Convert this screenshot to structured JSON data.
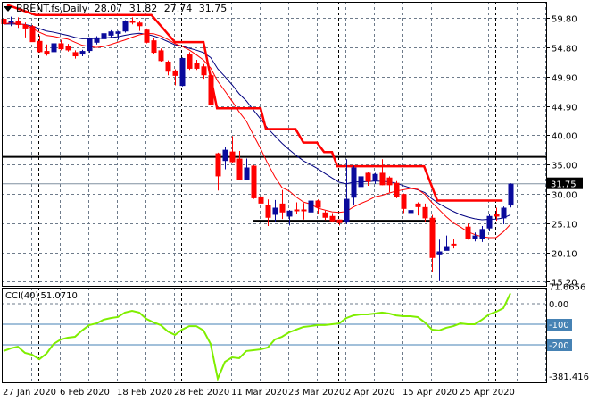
{
  "header": {
    "symbol": "BRENT.fs,Daily",
    "open": "28.07",
    "high": "31.82",
    "low": "27.74",
    "close": "31.75"
  },
  "cci_header": {
    "name": "CCI(40)",
    "value": "51.0710"
  },
  "colors": {
    "bull": "#0a0a9c",
    "bear": "#ff0000",
    "ma_blue": "#000080",
    "ma_red": "#ff0000",
    "step": "#ff0000",
    "cci": "#7fee00",
    "level": "#4682b4",
    "grid": "#6e7b8b"
  },
  "chart_data": [
    {
      "type": "candlestick",
      "title": "BRENT.fs,Daily",
      "price_axis_ticks": [
        "59.80",
        "54.80",
        "49.90",
        "44.90",
        "40.00",
        "35.00",
        "30.00",
        "25.10",
        "20.10",
        "15.20"
      ],
      "ylim": [
        15.2,
        59.8
      ],
      "current_price_label": "31.75",
      "date_labels": [
        {
          "bar": 0,
          "label": "27 Jan 2020"
        },
        {
          "bar": 8,
          "label": "6 Feb 2020"
        },
        {
          "bar": 16,
          "label": "18 Feb 2020"
        },
        {
          "bar": 24,
          "label": "28 Feb 2020"
        },
        {
          "bar": 32,
          "label": "11 Mar 2020"
        },
        {
          "bar": 40,
          "label": "23 Mar 2020"
        },
        {
          "bar": 48,
          "label": "2 Apr 2020"
        },
        {
          "bar": 56,
          "label": "15 Apr 2020"
        },
        {
          "bar": 64,
          "label": "25 Apr 2020"
        }
      ],
      "month_separators": [
        4.9,
        24.9,
        46.9,
        68.9
      ],
      "candles_ohlc": [
        [
          59.65,
          60.0,
          58.4,
          58.74
        ],
        [
          59.1,
          60.0,
          58.4,
          59.2
        ],
        [
          59.2,
          59.9,
          58.1,
          58.6
        ],
        [
          58.6,
          59.0,
          56.5,
          58.0
        ],
        [
          58.4,
          58.6,
          55.9,
          55.7
        ],
        [
          55.9,
          56.8,
          53.9,
          54.0
        ],
        [
          54.2,
          55.3,
          53.4,
          53.6
        ],
        [
          54.0,
          55.8,
          53.4,
          55.5
        ],
        [
          55.5,
          56.1,
          54.3,
          54.5
        ],
        [
          55.1,
          55.4,
          54.1,
          54.3
        ],
        [
          54.0,
          54.3,
          52.9,
          53.3
        ],
        [
          53.6,
          54.4,
          53.3,
          54.2
        ],
        [
          54.2,
          56.5,
          53.9,
          56.3
        ],
        [
          55.6,
          56.7,
          55.3,
          56.5
        ],
        [
          56.2,
          57.4,
          55.9,
          57.2
        ],
        [
          56.8,
          57.7,
          56.5,
          57.5
        ],
        [
          57.1,
          57.6,
          56.1,
          57.5
        ],
        [
          57.5,
          59.4,
          57.3,
          59.3
        ],
        [
          59.2,
          59.9,
          58.7,
          59.05
        ],
        [
          59.0,
          59.2,
          57.6,
          58.4
        ],
        [
          57.8,
          58.0,
          55.5,
          55.6
        ],
        [
          56.0,
          56.4,
          53.7,
          53.9
        ],
        [
          54.3,
          54.6,
          52.4,
          52.5
        ],
        [
          52.4,
          52.6,
          50.1,
          50.7
        ],
        [
          50.9,
          51.1,
          48.4,
          50.0
        ],
        [
          48.3,
          53.1,
          48.2,
          53.0
        ],
        [
          53.6,
          54.0,
          51.0,
          51.2
        ],
        [
          52.2,
          52.7,
          51.0,
          51.2
        ],
        [
          51.6,
          52.0,
          49.5,
          50.1
        ],
        [
          50.1,
          50.2,
          45.0,
          45.1
        ],
        [
          36.9,
          37.0,
          30.6,
          33.0
        ],
        [
          35.6,
          37.9,
          34.2,
          37.5
        ],
        [
          37.2,
          39.8,
          35.3,
          35.4
        ],
        [
          36.0,
          37.3,
          32.3,
          32.4
        ],
        [
          32.4,
          36.0,
          32.3,
          34.5
        ],
        [
          34.8,
          34.9,
          29.2,
          29.3
        ],
        [
          29.6,
          29.7,
          28.3,
          28.4
        ],
        [
          28.1,
          29.1,
          24.6,
          26.0
        ],
        [
          26.5,
          29.0,
          25.3,
          27.7
        ],
        [
          28.4,
          30.7,
          25.8,
          26.9
        ],
        [
          26.2,
          27.3,
          24.7,
          27.2
        ],
        [
          27.4,
          28.6,
          26.6,
          27.1
        ],
        [
          27.4,
          28.5,
          25.7,
          27.1
        ],
        [
          26.9,
          29.1,
          26.8,
          28.9
        ],
        [
          28.9,
          29.1,
          26.7,
          27.7
        ],
        [
          26.9,
          27.2,
          25.6,
          26.0
        ],
        [
          26.3,
          26.8,
          25.3,
          25.4
        ],
        [
          25.7,
          25.7,
          24.7,
          25.1
        ],
        [
          25.2,
          35.9,
          24.9,
          29.2
        ],
        [
          29.4,
          34.8,
          28.2,
          34.5
        ],
        [
          31.2,
          34.0,
          29.5,
          33.0
        ],
        [
          33.6,
          33.7,
          31.4,
          32.1
        ],
        [
          32.2,
          33.6,
          31.7,
          33.4
        ],
        [
          33.6,
          35.9,
          31.5,
          31.5
        ],
        [
          32.8,
          33.0,
          30.3,
          31.5
        ],
        [
          31.9,
          32.2,
          29.3,
          29.5
        ],
        [
          30.0,
          30.1,
          26.8,
          27.5
        ],
        [
          26.8,
          28.0,
          26.4,
          27.3
        ],
        [
          28.4,
          28.6,
          26.4,
          27.8
        ],
        [
          27.8,
          28.4,
          25.2,
          25.9
        ],
        [
          26.0,
          26.5,
          16.9,
          19.2
        ],
        [
          19.8,
          22.3,
          15.4,
          20.3
        ],
        [
          20.4,
          23.0,
          21.1,
          21.2
        ],
        [
          21.6,
          22.4,
          20.8,
          21.3
        ],
        null,
        [
          24.5,
          25.0,
          22.3,
          22.4
        ],
        [
          22.4,
          23.5,
          22.0,
          23.0
        ],
        [
          22.4,
          24.6,
          21.9,
          24.1
        ],
        [
          24.2,
          26.6,
          23.7,
          26.3
        ],
        [
          26.6,
          27.7,
          25.5,
          26.2
        ],
        [
          25.9,
          27.9,
          24.9,
          27.7
        ],
        [
          28.07,
          31.82,
          27.74,
          31.75
        ]
      ],
      "indicators": {
        "blue_line": "EMA(20) of close",
        "red_line": "SMA(10) of close"
      },
      "step_line": [
        [
          0.5,
          62
        ],
        [
          4.5,
          60.3
        ],
        [
          20.7,
          60.3
        ],
        [
          24,
          55.7
        ],
        [
          28,
          55.7
        ],
        [
          29.9,
          44.5
        ],
        [
          36,
          44.5
        ],
        [
          36.75,
          41.0
        ],
        [
          40.9,
          41.0
        ],
        [
          42,
          38.7
        ],
        [
          43.9,
          38.7
        ],
        [
          44.9,
          37.1
        ],
        [
          46,
          37.1
        ],
        [
          46.75,
          34.7
        ],
        [
          58.9,
          34.7
        ],
        [
          60.75,
          28.9
        ],
        [
          69.9,
          28.9
        ]
      ],
      "horizontal_lines": [
        {
          "price": 36.3,
          "from_bar": -1,
          "to_bar": 76
        },
        {
          "price": 25.5,
          "from_bar": 34.9,
          "to_bar": 60.5
        }
      ]
    },
    {
      "type": "line",
      "title": "CCI(40)",
      "axis_labels": [
        "71.6656",
        "0.00",
        "-100",
        "-200",
        "-381.416"
      ],
      "ylim": [
        -381.416,
        71.6656
      ],
      "levels": [
        -100,
        -200
      ],
      "values": [
        -230,
        -217,
        -209,
        -239,
        -248,
        -270,
        -243,
        -196,
        -174,
        -165,
        -161,
        -130,
        -104,
        -96,
        -78,
        -70,
        -65,
        -43,
        -35,
        -43,
        -74,
        -91,
        -104,
        -135,
        -152,
        -126,
        -109,
        -109,
        -130,
        -196,
        -365,
        -283,
        -261,
        -265,
        -230,
        -226,
        -222,
        -213,
        -174,
        -161,
        -139,
        -126,
        -113,
        -109,
        -104,
        -104,
        -100,
        -96,
        -70,
        -57,
        -52,
        -52,
        -48,
        -43,
        -48,
        -57,
        -61,
        -61,
        -65,
        -91,
        -126,
        -130,
        -117,
        -109,
        -96,
        -100,
        -100,
        -78,
        -52,
        -39,
        -22,
        51
      ]
    }
  ]
}
